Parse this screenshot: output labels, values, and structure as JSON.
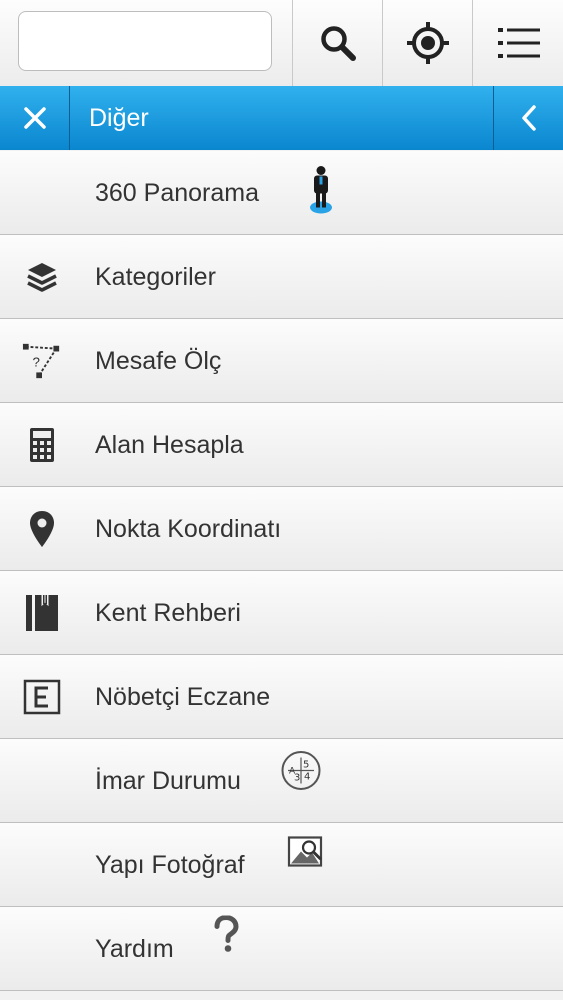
{
  "search": {
    "value": "",
    "placeholder": ""
  },
  "toolbar": {
    "search_icon": "magnifier-icon",
    "locate_icon": "crosshair-icon",
    "menu_icon": "list-icon"
  },
  "header": {
    "title": "Diğer",
    "close_icon": "close-icon",
    "back_icon": "chevron-left-icon"
  },
  "menu": {
    "items": [
      {
        "label": "360 Panorama",
        "icon": "street-view-person-icon"
      },
      {
        "label": "Kategoriler",
        "icon": "layers-icon"
      },
      {
        "label": "Mesafe Ölç",
        "icon": "measure-distance-icon"
      },
      {
        "label": "Alan Hesapla",
        "icon": "calculator-icon"
      },
      {
        "label": "Nokta Koordinatı",
        "icon": "map-pin-icon"
      },
      {
        "label": "Kent Rehberi",
        "icon": "guide-book-icon"
      },
      {
        "label": "Nöbetçi Eczane",
        "icon": "pharmacy-e-icon"
      },
      {
        "label": "İmar Durumu",
        "icon": "zoning-plan-icon"
      },
      {
        "label": "Yapı Fotoğraf",
        "icon": "photo-search-icon"
      },
      {
        "label": "Yardım",
        "icon": "question-icon"
      }
    ]
  },
  "colors": {
    "header_blue": "#1a9be0",
    "icon_gray": "#333333",
    "accent_blue": "#2aa3e6"
  }
}
